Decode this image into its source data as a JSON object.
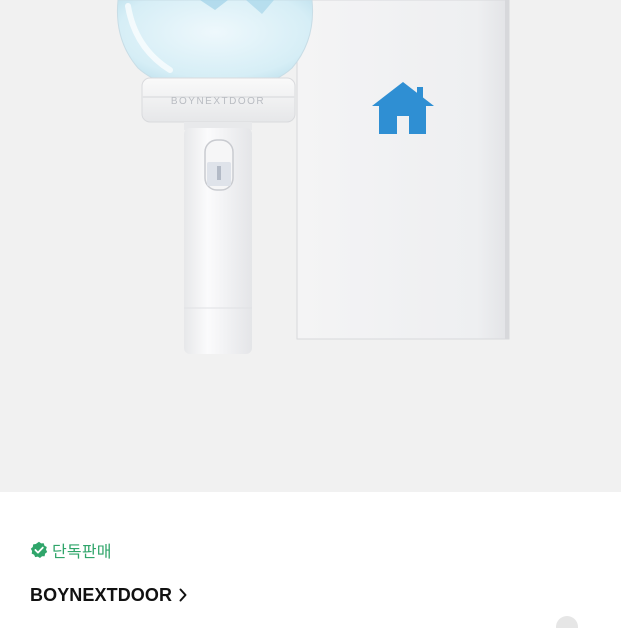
{
  "product_image": {
    "alt": "official light stick with packaging box",
    "engraving": "BOYNEXTDOOR",
    "box_icon": "house-icon"
  },
  "badge": {
    "icon": "verified-check-icon",
    "label": "단독판매",
    "color": "#2fa56a"
  },
  "artist": {
    "name": "BOYNEXTDOOR",
    "chevron_icon": "chevron-right-icon"
  },
  "colors": {
    "hero_bg": "#f1f1f1",
    "house_blue": "#2f8fd3"
  }
}
